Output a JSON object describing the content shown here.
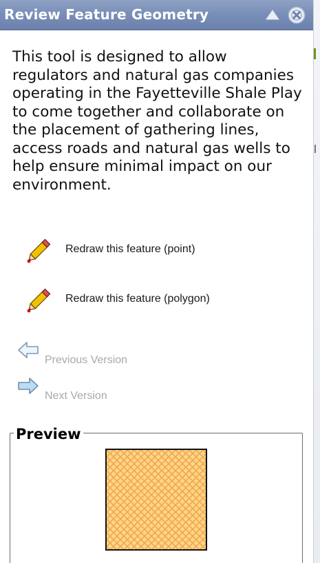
{
  "window": {
    "title": "Review Feature Geometry",
    "collapse_icon": "triangle-up-icon",
    "close_icon": "circle-x-icon"
  },
  "description": "This tool is designed to allow regulators and natural gas companies operating in the Fayetteville Shale Play to come together and collaborate on the placement of gathering lines, access roads and natural gas wells to help ensure minimal impact on our environment.",
  "actions": [
    {
      "label": "Redraw this feature (point)",
      "icon": "pencil-icon"
    },
    {
      "label": "Redraw this feature (polygon)",
      "icon": "pencil-icon"
    }
  ],
  "navigation": {
    "previous_label": "Previous Version",
    "next_label": "Next Version",
    "previous_icon": "arrow-left-icon",
    "next_icon": "arrow-right-icon"
  },
  "preview": {
    "legend": "Preview",
    "fill_color": "#ffd58a",
    "hatch_color": "#f0a84a",
    "outline_color": "#111111"
  },
  "colors": {
    "titlebar": "#7a8fb8",
    "disabled_text": "#a9a9a9",
    "arrow_fill": "#bcdcf3"
  }
}
